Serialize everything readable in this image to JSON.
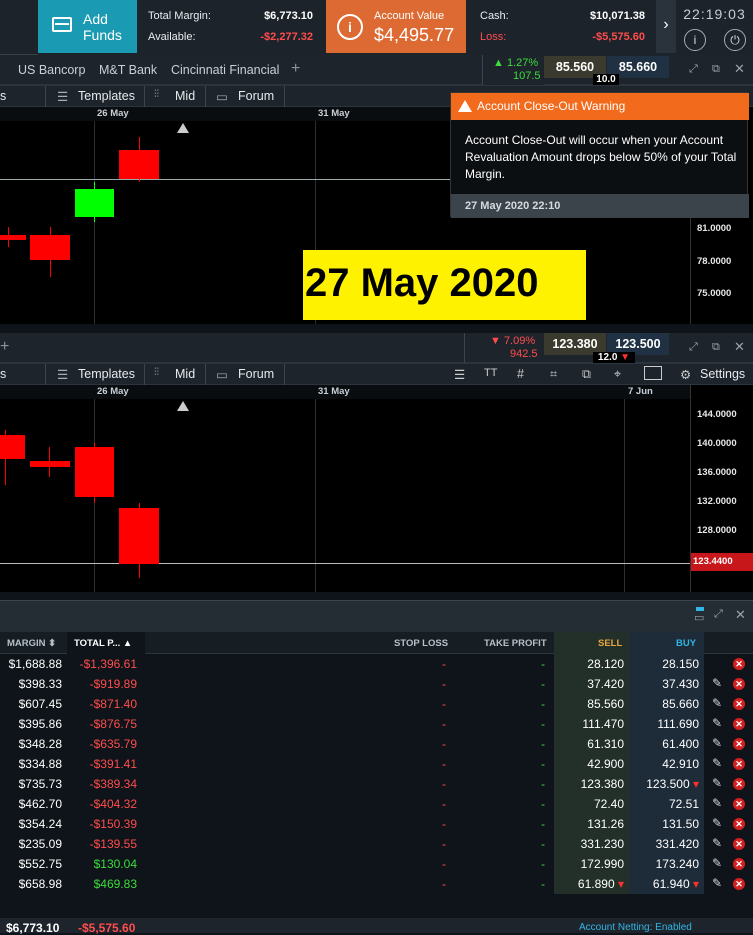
{
  "topbar": {
    "add_funds": "Add Funds",
    "total_margin_label": "Total Margin:",
    "total_margin": "$6,773.10",
    "available_label": "Available:",
    "available": "-$2,277.32",
    "account_value_label": "Account Value",
    "account_value": "$4,495.77",
    "cash_label": "Cash:",
    "cash": "$10,071.38",
    "loss_label": "Loss:",
    "loss": "-$5,575.60",
    "clock": "22:19:03",
    "info_icon": "info-icon",
    "power_icon": "power-icon"
  },
  "panel1": {
    "tabs": [
      "US Bancorp",
      "M&T Bank",
      "Cincinnati Financial"
    ],
    "add_tab": "+",
    "change": "▲ 1.27%",
    "change_amt": "107.5",
    "sell": "85.560",
    "buy": "85.660",
    "spread": "10.0",
    "toolbar": {
      "partial": "s",
      "templates": "Templates",
      "mid": "Mid",
      "forum": "Forum"
    },
    "dates": [
      "26 May",
      "31 May"
    ],
    "axis": [
      "81.0000",
      "78.0000",
      "75.0000"
    ]
  },
  "popup": {
    "title": "Account Close-Out Warning",
    "body": "Account Close-Out will occur when your Account Revaluation Amount drops below 50% of your Total Margin.",
    "time": "27 May 2020 22:10"
  },
  "banner": "27 May 2020",
  "panel2": {
    "add_tab": "+",
    "change": "▼ 7.09%",
    "change_amt": "942.5",
    "sell": "123.380",
    "buy": "123.500",
    "spread": "12.0 ▼",
    "toolbar": {
      "partial": "s",
      "templates": "Templates",
      "mid": "Mid",
      "forum": "Forum",
      "tt": "TT",
      "settings": "Settings"
    },
    "dates": [
      "26 May",
      "31 May",
      "7 Jun"
    ],
    "axis": [
      "144.0000",
      "140.0000",
      "136.0000",
      "132.0000",
      "128.0000"
    ],
    "current": "123.4400"
  },
  "positions": {
    "headers": {
      "margin": "MARGIN ⬍",
      "total": "TOTAL P... ▲",
      "stop": "STOP LOSS",
      "take": "TAKE PROFIT",
      "sell": "SELL",
      "buy": "BUY"
    },
    "rows": [
      {
        "margin": "$1,688.88",
        "pl": "-$1,396.61",
        "stop": "-",
        "take": "-",
        "sell": "28.120",
        "buy": "28.150",
        "edit": false
      },
      {
        "margin": "$398.33",
        "pl": "-$919.89",
        "stop": "-",
        "take": "-",
        "sell": "37.420",
        "buy": "37.430",
        "edit": true
      },
      {
        "margin": "$607.45",
        "pl": "-$871.40",
        "stop": "-",
        "take": "-",
        "sell": "85.560",
        "buy": "85.660",
        "edit": true
      },
      {
        "margin": "$395.86",
        "pl": "-$876.75",
        "stop": "-",
        "take": "-",
        "sell": "111.470",
        "buy": "111.690",
        "edit": true
      },
      {
        "margin": "$348.28",
        "pl": "-$635.79",
        "stop": "-",
        "take": "-",
        "sell": "61.310",
        "buy": "61.400",
        "edit": true
      },
      {
        "margin": "$334.88",
        "pl": "-$391.41",
        "stop": "-",
        "take": "-",
        "sell": "42.900",
        "buy": "42.910",
        "edit": true
      },
      {
        "margin": "$735.73",
        "pl": "-$389.34",
        "stop": "-",
        "take": "-",
        "sell": "123.380",
        "buy": "123.500 ▾",
        "edit": true
      },
      {
        "margin": "$462.70",
        "pl": "-$404.32",
        "stop": "-",
        "take": "-",
        "sell": "72.40",
        "buy": "72.51",
        "edit": true
      },
      {
        "margin": "$354.24",
        "pl": "-$150.39",
        "stop": "-",
        "take": "-",
        "sell": "131.26",
        "buy": "131.50",
        "edit": true
      },
      {
        "margin": "$235.09",
        "pl": "-$139.55",
        "stop": "-",
        "take": "-",
        "sell": "331.230",
        "buy": "331.420",
        "edit": true
      },
      {
        "margin": "$552.75",
        "pl": "$130.04",
        "stop": "-",
        "take": "-",
        "sell": "172.990",
        "buy": "173.240",
        "edit": true
      },
      {
        "margin": "$658.98",
        "pl": "$469.83",
        "stop": "-",
        "take": "-",
        "sell": "61.890 ▾",
        "buy": "61.940 ▾",
        "edit": true
      }
    ]
  },
  "footer": {
    "total_margin": "$6,773.10",
    "total_pl": "-$5,575.60",
    "netting": "Account Netting: Enabled"
  },
  "colors": {
    "accent": "#1b9bb3",
    "orange": "#dd6a33",
    "red": "#ff0000",
    "green": "#00ff00"
  }
}
